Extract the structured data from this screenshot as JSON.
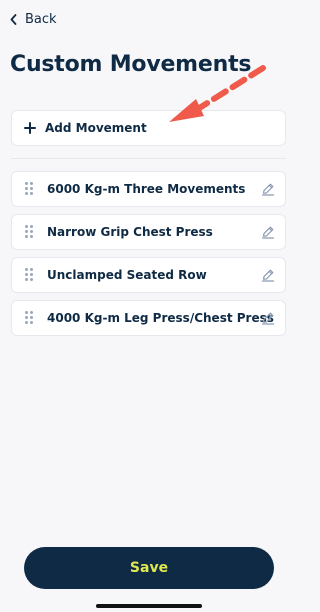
{
  "nav": {
    "back_label": "Back",
    "back_icon": "chevron-left-icon"
  },
  "page": {
    "title": "Custom Movements"
  },
  "actions": {
    "add_label": "Add Movement",
    "add_icon": "plus-icon",
    "save_label": "Save"
  },
  "movements": [
    {
      "name": "6000 Kg-m Three Movements",
      "edit_icon": "pencil-icon",
      "handle_icon": "drag-handle-icon"
    },
    {
      "name": "Narrow Grip Chest Press",
      "edit_icon": "pencil-icon",
      "handle_icon": "drag-handle-icon"
    },
    {
      "name": "Unclamped Seated Row",
      "edit_icon": "pencil-icon",
      "handle_icon": "drag-handle-icon"
    },
    {
      "name": "4000 Kg-m Leg Press/Chest Press",
      "edit_icon": "pencil-icon",
      "handle_icon": "drag-handle-icon"
    }
  ],
  "colors": {
    "primary": "#0f2a44",
    "accent": "#dfe84e",
    "annotation": "#ef5a4b",
    "background": "#f7f7fa",
    "card": "#ffffff"
  }
}
